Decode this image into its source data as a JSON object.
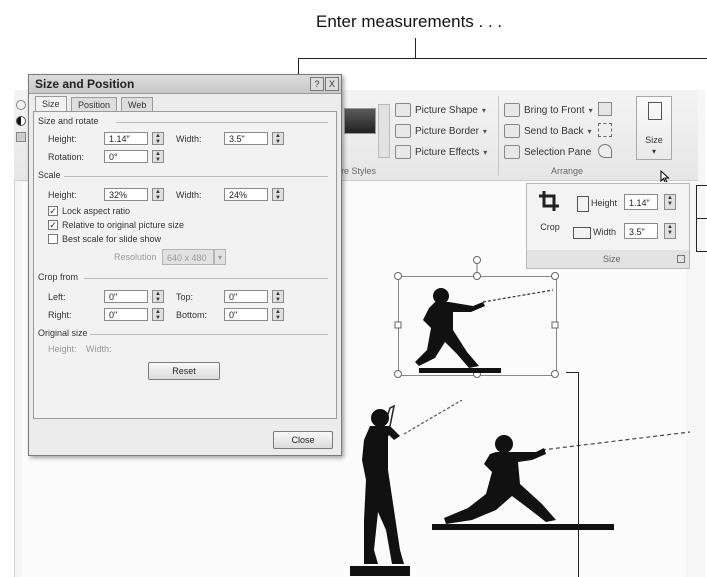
{
  "callouts": {
    "top": "Enter measurements . . ."
  },
  "ribbon": {
    "picture_styles_label": "ure Styles",
    "picture_shape": "Picture Shape",
    "picture_border": "Picture Border",
    "picture_effects": "Picture Effects",
    "bring_to_front": "Bring to Front",
    "send_to_back": "Send to Back",
    "selection_pane": "Selection Pane",
    "arrange_label": "Arrange",
    "size_button": "Size"
  },
  "size_panel": {
    "crop_label": "Crop",
    "height_label": "Height",
    "height_value": "1.14\"",
    "width_label": "Width",
    "width_value": "3.5\"",
    "group_label": "Size"
  },
  "dialog": {
    "title": "Size and Position",
    "help_btn": "?",
    "close_btn": "X",
    "tabs": [
      "Size",
      "Position",
      "Web"
    ],
    "size_rotate": {
      "section": "Size and rotate",
      "height_label": "Height:",
      "height_value": "1.14\"",
      "width_label": "Width:",
      "width_value": "3.5\"",
      "rotation_label": "Rotation:",
      "rotation_value": "0°"
    },
    "scale": {
      "section": "Scale",
      "height_label": "Height:",
      "height_value": "32%",
      "width_label": "Width:",
      "width_value": "24%",
      "lock_aspect": "Lock aspect ratio",
      "relative_original": "Relative to original picture size",
      "best_scale": "Best scale for slide show",
      "resolution_label": "Resolution",
      "resolution_value": "640 x 480"
    },
    "crop": {
      "section": "Crop from",
      "left_label": "Left:",
      "left_value": "0\"",
      "top_label": "Top:",
      "top_value": "0\"",
      "right_label": "Right:",
      "right_value": "0\"",
      "bottom_label": "Bottom:",
      "bottom_value": "0\""
    },
    "original": {
      "section": "Original size",
      "height_label": "Height:",
      "width_label": "Width:"
    },
    "reset_btn": "Reset",
    "close_button": "Close"
  }
}
